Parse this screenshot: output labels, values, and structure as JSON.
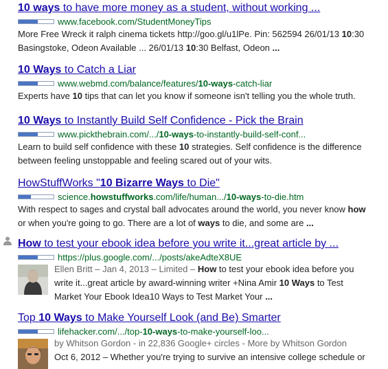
{
  "results": [
    {
      "title_pre": "",
      "title_bold": "10 ways",
      "title_post": " to have more money as a student, without working ...",
      "pagerank": 0.55,
      "url_pre": "www.facebook.com/StudentMoneyTips",
      "url_bold": "",
      "url_post": "",
      "line1": "More Free Wreck it ralph cinema tickets http://goo.gl/u1lPe. Pin: 562594 26/01/13 ",
      "line1_b1": "10",
      "line1_post": ":30",
      "line2": "Basingstoke, Odeon Available ... 26/01/13 ",
      "line2_b1": "10",
      "line2_post": ":30 Belfast, Odeon ",
      "line2_b2": "..."
    },
    {
      "title_bold": "10 Ways",
      "title_post": " to Catch a Liar",
      "pagerank": 0.55,
      "url_pre": "www.webmd.com/balance/features/",
      "url_bold": "10-ways",
      "url_post": "-catch-liar",
      "line1": "Experts have ",
      "line1_b1": "10",
      "line1_post": " tips that can let you know if someone isn't telling you the whole truth."
    },
    {
      "title_bold": "10 Ways",
      "title_post": " to Instantly Build Self Confidence - Pick the Brain",
      "pagerank": 0.55,
      "url_pre": "www.pickthebrain.com/.../",
      "url_bold": "10-ways",
      "url_post": "-to-instantly-build-self-conf...",
      "line1": "Learn to build self confidence with these ",
      "line1_b1": "10",
      "line1_post": " strategies. Self confidence is the difference",
      "line2": "between feeling unstoppable and feeling scared out of your wits."
    },
    {
      "title_pre": "HowStuffWorks \"",
      "title_bold": "10 Bizarre Ways",
      "title_post": " to Die\"",
      "pagerank": 0.35,
      "url_pre": "science.",
      "url_bold": "howstuffworks",
      "url_post": ".com/life/human.../",
      "url_bold2": "10-ways",
      "url_post2": "-to-die.htm",
      "line1": "With respect to sages and crystal ball advocates around the world, you never know ",
      "line1_b1": "how",
      "line2": "or when you're going to go. There are a lot of ",
      "line2_b1": "ways",
      "line2_post": " to die, and some are ",
      "line2_b2": "..."
    },
    {
      "title_bold": "How",
      "title_post": " to test your ebook idea before you write it...great article by ...",
      "pagerank": 0.55,
      "url_pre": "https://plus.google.com/.../posts/akeAdteX8UE",
      "meta": "Ellen Britt – Jan 4, 2013 – Limited – ",
      "meta_b": "How",
      "meta_post": " to test your ebook idea before you",
      "line2": "write it...great article by award-winning writer +Nina Amir ",
      "line2_b1": "10 Ways",
      "line2_post": " to Test",
      "line3": "Market Your Ebook Idea10 Ways to Test Market Your ",
      "line3_b": "..."
    },
    {
      "title_pre": "Top ",
      "title_bold": "10 Ways",
      "title_post": " to Make Yourself Look (and Be) Smarter",
      "pagerank": 0.55,
      "url_pre": "lifehacker.com/.../top-",
      "url_bold": "10-ways",
      "url_post": "-to-make-yourself-loo...",
      "meta": "by Whitson Gordon - in 22,836 Google+ circles - More by Whitson Gordon",
      "line2": "Oct 6, 2012 – Whether you're trying to survive an intensive college schedule or"
    }
  ],
  "icons": {
    "author_icon": "person-icon",
    "thumb1": "author-photo-ellen-britt",
    "thumb2": "author-photo-whitson-gordon"
  },
  "colors": {
    "link": "#1a0dab",
    "url": "#006621",
    "text": "#222222",
    "meta": "#666666"
  }
}
